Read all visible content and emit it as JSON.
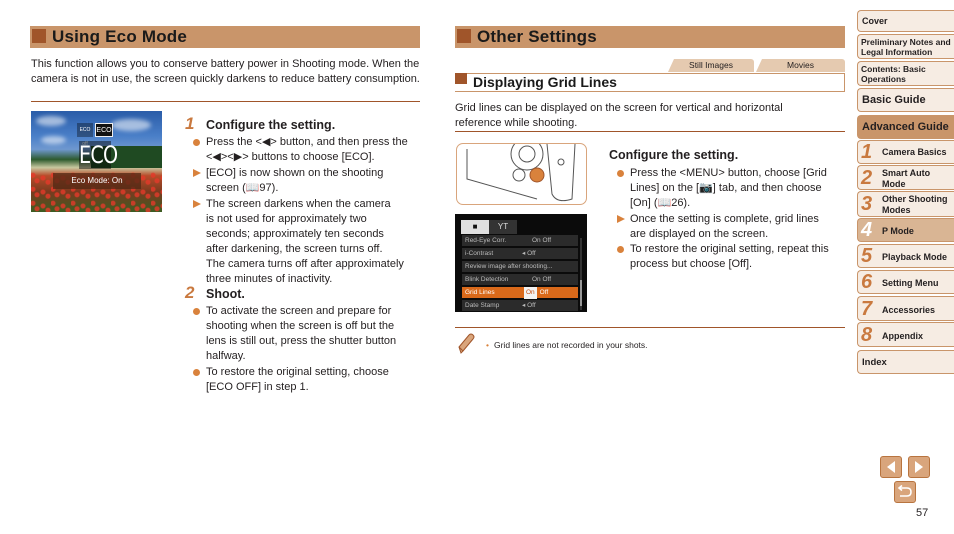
{
  "left_section": {
    "title": "Using Eco Mode",
    "intro": "This function allows you to conserve battery power in Shooting mode. When the camera is not in use, the screen quickly darkens to reduce battery consumption.",
    "screen_image": {
      "icon_left": "ECO off",
      "icon_right": "ECO",
      "big_label": "ECO",
      "caption": "Eco Mode: On"
    },
    "steps": [
      {
        "number": "1",
        "title": "Configure the setting.",
        "items": [
          {
            "type": "dot",
            "lines": [
              "Press the <◀> button, and then press the",
              "<◀><▶> buttons to choose [ECO]."
            ]
          },
          {
            "type": "arrow",
            "lines": [
              "[ECO] is now shown on the shooting",
              "screen (📖97)."
            ]
          },
          {
            "type": "arrow",
            "lines": [
              "The screen darkens when the camera",
              "is not used for approximately two",
              "seconds; approximately ten seconds",
              "after darkening, the screen turns off.",
              "The camera turns off after approximately",
              "three minutes of inactivity."
            ]
          }
        ]
      },
      {
        "number": "2",
        "title": "Shoot.",
        "items": [
          {
            "type": "dot",
            "lines": [
              "To activate the screen and prepare for",
              "shooting when the screen is off but the",
              "lens is still out, press the shutter button",
              "halfway."
            ]
          },
          {
            "type": "dot",
            "lines": [
              "To restore the original setting, choose",
              "[ECO OFF] in step 1."
            ]
          }
        ]
      }
    ]
  },
  "right_section": {
    "title": "Other Settings",
    "tabs": [
      "Still Images",
      "Movies"
    ],
    "subtitle": "Displaying Grid Lines",
    "intro": "Grid lines can be displayed on the screen for vertical and horizontal reference while shooting.",
    "menu_screen": {
      "tabs": [
        "camera",
        "YT"
      ],
      "rows": [
        {
          "label": "Red-Eye Corr.",
          "value": "On  Off",
          "selected": false
        },
        {
          "label": "i-Contrast",
          "value": "◂ Off",
          "selected": false
        },
        {
          "label": "Review image after shooting...",
          "value": "",
          "selected": false
        },
        {
          "label": "Blink Detection",
          "value": "On  Off",
          "selected": false
        },
        {
          "label": "Grid Lines",
          "value_on": "On",
          "value_off": "Off",
          "selected": true
        },
        {
          "label": "Date Stamp",
          "value": "◂ Off",
          "selected": false
        }
      ]
    },
    "step": {
      "title": "Configure the setting.",
      "items": [
        {
          "type": "dot",
          "lines": [
            "Press the <MENU> button, choose [Grid",
            "Lines] on the [📷] tab, and then choose",
            "[On] (📖26)."
          ]
        },
        {
          "type": "arrow",
          "lines": [
            "Once the setting is complete, grid lines",
            "are displayed on the screen."
          ]
        },
        {
          "type": "dot",
          "lines": [
            "To restore the original setting, repeat this",
            "process but choose [Off]."
          ]
        }
      ]
    },
    "note": "Grid lines are not recorded in your shots."
  },
  "sidebar": {
    "top_items": [
      {
        "label": "Cover"
      },
      {
        "label": "Preliminary Notes and Legal Information"
      },
      {
        "label": "Contents: Basic Operations"
      },
      {
        "label": "Basic Guide"
      },
      {
        "label": "Advanced Guide"
      }
    ],
    "chapters": [
      {
        "num": "1",
        "label": "Camera Basics"
      },
      {
        "num": "2",
        "label": "Smart Auto Mode"
      },
      {
        "num": "3",
        "label": "Other Shooting Modes"
      },
      {
        "num": "4",
        "label": "P Mode"
      },
      {
        "num": "5",
        "label": "Playback Mode"
      },
      {
        "num": "6",
        "label": "Setting Menu"
      },
      {
        "num": "7",
        "label": "Accessories"
      },
      {
        "num": "8",
        "label": "Appendix"
      }
    ],
    "index": "Index"
  },
  "navigation": {
    "prev_icon": "prev-page-icon",
    "next_icon": "next-page-icon",
    "return_icon": "return-icon",
    "page_number": "57"
  },
  "colors": {
    "header_bar": "#c9956a",
    "header_mark": "#a0552a",
    "accent_orange": "#d9823c",
    "sidebar_bg": "#f6ece3",
    "sidebar_active": "#c9956a",
    "menu_selected": "#d9691a"
  }
}
